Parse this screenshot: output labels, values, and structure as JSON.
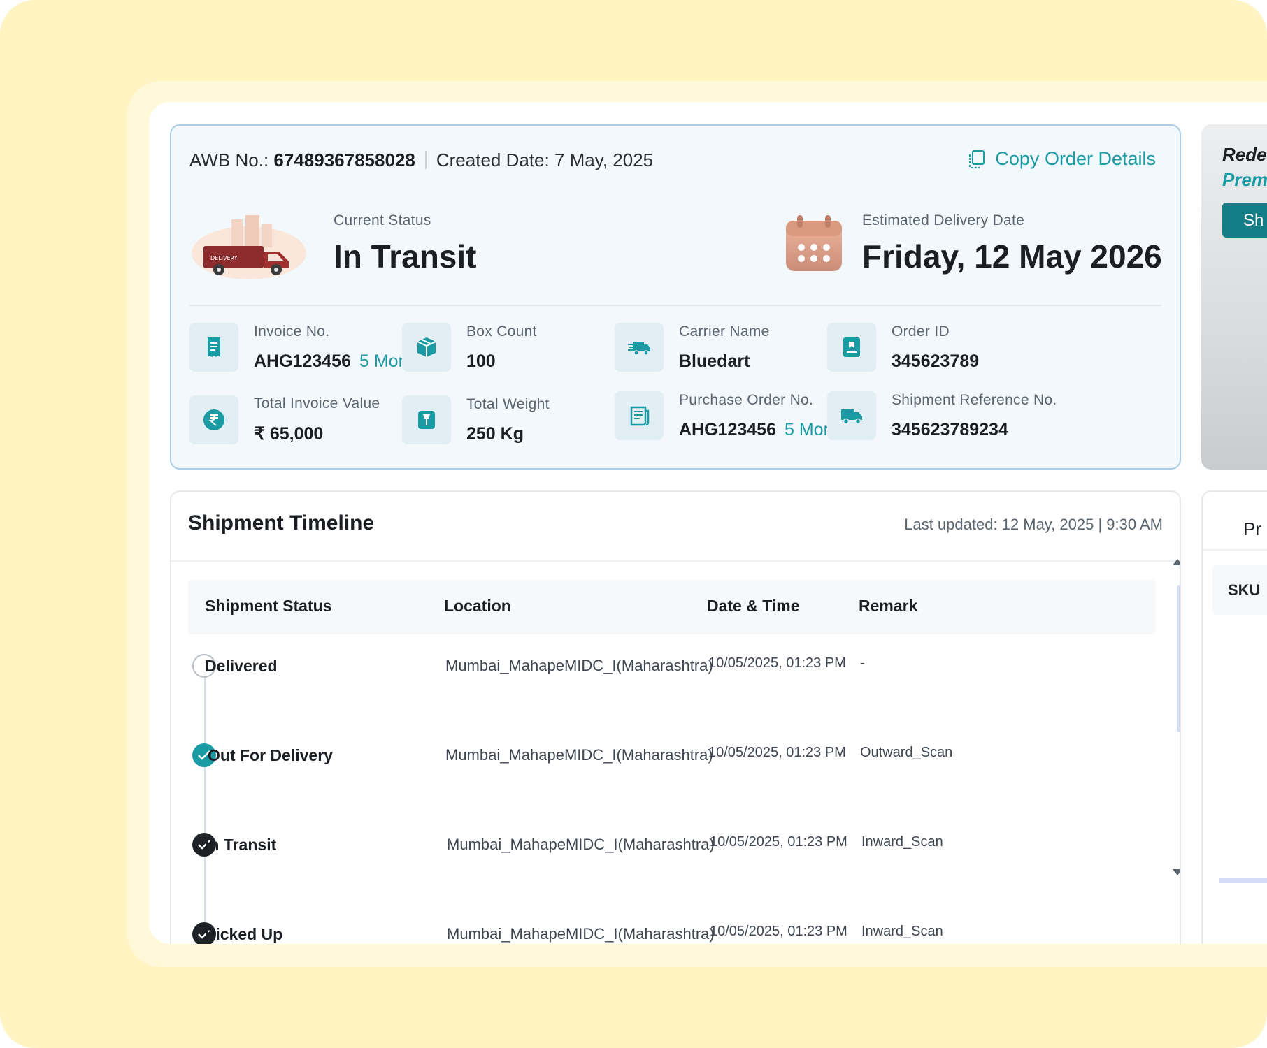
{
  "header": {
    "awb_label": "AWB No.:",
    "awb_value": "67489367858028",
    "created": "Created Date: 7 May, 2025",
    "copy_label": "Copy Order Details"
  },
  "status": {
    "current_label": "Current Status",
    "current_value": "In Transit",
    "delivery_badge": "DELIVERY",
    "eta_label": "Estimated Delivery Date",
    "eta_value": "Friday, 12 May 2026"
  },
  "info": {
    "invoice_label": "Invoice No.",
    "invoice_value": "AHG123456",
    "invoice_more": "5 More",
    "box_label": "Box Count",
    "box_value": "100",
    "carrier_label": "Carrier Name",
    "carrier_value": "Bluedart",
    "order_label": "Order ID",
    "order_value": "345623789",
    "total_invoice_label": "Total Invoice Value",
    "total_invoice_value": "₹ 65,000",
    "weight_label": "Total Weight",
    "weight_value": "250 Kg",
    "po_label": "Purchase Order No.",
    "po_value": "AHG123456",
    "po_more": "5 More",
    "ship_ref_label": "Shipment Reference No.",
    "ship_ref_value": "345623789234"
  },
  "promo": {
    "line1": "Rede",
    "line2": "Prem",
    "button": "Sh"
  },
  "timeline": {
    "title": "Shipment Timeline",
    "updated": "Last updated: 12 May, 2025  |  9:30 AM",
    "columns": [
      "Shipment Status",
      "Location",
      "Date & Time",
      "Remark"
    ],
    "rows": [
      {
        "status": "Delivered",
        "location": "Mumbai_MahapeMIDC_I(Maharashtra)",
        "datetime": "10/05/2025, 01:23 PM",
        "remark": "-",
        "state": "pending"
      },
      {
        "status": "Out For Delivery",
        "location": "Mumbai_MahapeMIDC_I(Maharashtra)",
        "datetime": "10/05/2025, 01:23 PM",
        "remark": "Outward_Scan",
        "state": "current"
      },
      {
        "status": "In Transit",
        "location": "Mumbai_MahapeMIDC_I(Maharashtra)",
        "datetime": "10/05/2025, 01:23 PM",
        "remark": "Inward_Scan",
        "state": "done"
      },
      {
        "status": "Picked Up",
        "location": "Mumbai_MahapeMIDC_I(Maharashtra)",
        "datetime": "10/05/2025, 01:23 PM",
        "remark": "Inward_Scan",
        "state": "done"
      }
    ]
  },
  "side_panel": {
    "title": "Pr",
    "sku_header": "SKU"
  },
  "colors": {
    "accent": "#1a9aa3",
    "background": "#fff4c2",
    "card": "#f3f8fc"
  }
}
